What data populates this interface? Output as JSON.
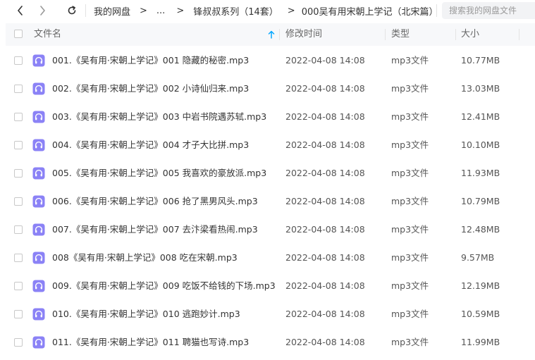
{
  "nav": {
    "breadcrumbs": [
      "我的网盘",
      "...",
      "锋叔叔系列（14套）",
      "000吴有用宋朝上学记（北宋篇）"
    ],
    "separator": ">"
  },
  "search": {
    "placeholder": "搜索我的网盘文件"
  },
  "table": {
    "columns": {
      "name": "文件名",
      "mtime": "修改时间",
      "type": "类型",
      "size": "大小"
    },
    "rows": [
      {
        "name": "001.《吴有用·宋朝上学记》001 隐藏的秘密.mp3",
        "mtime": "2022-04-08 14:08",
        "type": "mp3文件",
        "size": "10.77MB"
      },
      {
        "name": "002.《吴有用·宋朝上学记》002 小诗仙归来.mp3",
        "mtime": "2022-04-08 14:08",
        "type": "mp3文件",
        "size": "13.03MB"
      },
      {
        "name": "003.《吴有用·宋朝上学记》003 中岩书院遇苏轼.mp3",
        "mtime": "2022-04-08 14:08",
        "type": "mp3文件",
        "size": "12.41MB"
      },
      {
        "name": "004.《吴有用·宋朝上学记》004 才子大比拼.mp3",
        "mtime": "2022-04-08 14:08",
        "type": "mp3文件",
        "size": "10.10MB"
      },
      {
        "name": "005.《吴有用·宋朝上学记》005 我喜欢的豪放派.mp3",
        "mtime": "2022-04-08 14:08",
        "type": "mp3文件",
        "size": "11.93MB"
      },
      {
        "name": "006.《吴有用·宋朝上学记》006 抢了黑男风头.mp3",
        "mtime": "2022-04-08 14:08",
        "type": "mp3文件",
        "size": "10.79MB"
      },
      {
        "name": "007.《吴有用·宋朝上学记》007 去汴梁看热闹.mp3",
        "mtime": "2022-04-08 14:08",
        "type": "mp3文件",
        "size": "12.48MB"
      },
      {
        "name": "008《吴有用·宋朝上学记》008 吃在宋朝.mp3",
        "mtime": "2022-04-08 14:08",
        "type": "mp3文件",
        "size": "9.57MB"
      },
      {
        "name": "009.《吴有用·宋朝上学记》009 吃饭不给钱的下场.mp3",
        "mtime": "2022-04-08 14:08",
        "type": "mp3文件",
        "size": "12.19MB"
      },
      {
        "name": "010.《吴有用·宋朝上学记》010 逃跑妙计.mp3",
        "mtime": "2022-04-08 14:08",
        "type": "mp3文件",
        "size": "10.59MB"
      },
      {
        "name": "011.《吴有用·宋朝上学记》011 聘猫也写诗.mp3",
        "mtime": "2022-04-08 14:08",
        "type": "mp3文件",
        "size": "11.99MB"
      }
    ]
  },
  "icons": {
    "back": "chevron-left-icon",
    "forward": "chevron-right-icon",
    "refresh": "refresh-icon",
    "file": "audio-file-icon",
    "sort": "sort-ascending-icon"
  },
  "colors": {
    "accent": "#06a7ff",
    "file_icon": "#8b82f6",
    "header_bg": "#f7f8fa",
    "search_bg": "#f2f3f5"
  }
}
